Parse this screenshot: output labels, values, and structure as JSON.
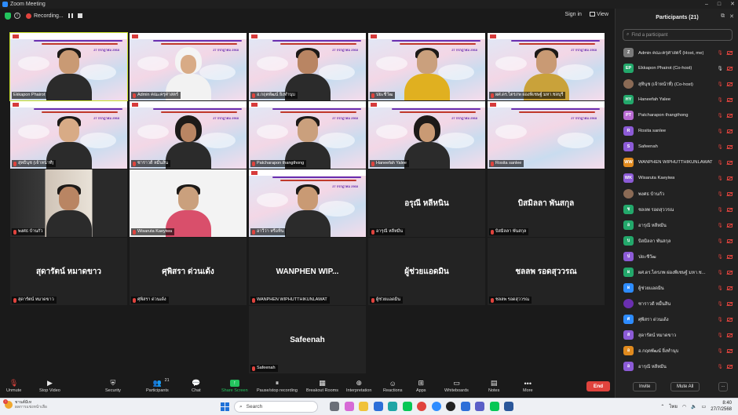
{
  "window": {
    "title": "Zoom Meeting",
    "controls": [
      "–",
      "□",
      "✕"
    ]
  },
  "meeting_bar": {
    "recording_label": "Recording...",
    "sign_in": "Sign in",
    "view": "View"
  },
  "slide": {
    "date": "27 กรกฎาคม 2568"
  },
  "tiles": [
    {
      "name": "Ekkapon Phairot",
      "video": true,
      "active": true,
      "person": "man-glasses"
    },
    {
      "name": "Admin คณะครุศาสตร์",
      "video": true,
      "person": "woman-hijab-white"
    },
    {
      "name": "อ.กฤตพัฒน์ ยิ่งทำนุบ",
      "video": true,
      "person": "man-glasses"
    },
    {
      "name": "ปยะชีวัฒ",
      "video": true,
      "person": "man-yellow"
    },
    {
      "name": "ผศ.ดร.ไตรภพ ผ่องพิเชษฐ์ มหา.ชลบุรี",
      "video": true,
      "person": "man-batik"
    },
    {
      "name": "สุทธินุช (เจ้าหน้าที่)",
      "video": true,
      "person": "man-young"
    },
    {
      "name": "ซาราวดี หมื่นสิน",
      "video": true,
      "person": "woman-hijab-black"
    },
    {
      "name": "Patcharapon thangthong",
      "video": true,
      "person": "woman-young"
    },
    {
      "name": "Haneefah Yalee",
      "video": true,
      "person": "woman-hijab-black"
    },
    {
      "name": "Rosita sanlee",
      "video": true,
      "person": "none"
    },
    {
      "name": "พงศธ บ้านกัว",
      "video": true,
      "person": "woman-room"
    },
    {
      "name": "Wisaruta Kaeyiwa",
      "video": true,
      "person": "woman-white"
    },
    {
      "name": "อาวีว่า หรือทิน",
      "video": true,
      "person": "woman-young"
    },
    {
      "name": "อารุณี หลีหมีน",
      "big": "อรุณี หลีหนิน",
      "video": false
    },
    {
      "name": "บิสมิลลา พันสกุล",
      "big": "บิสมิลลา พันสกุล",
      "video": false
    },
    {
      "name": "สุดารัตน์ หมาดขาว",
      "big": "สุดารัตน์ หมาดขาว",
      "video": false
    },
    {
      "name": "ศุพิสรา ด่วนเด้ง",
      "big": "ศุพิสรา ด่วนเด้ง",
      "video": false
    },
    {
      "name": "WANPHEN WIPHUTTHIKUNLAWAT",
      "big": "WANPHEN WIP...",
      "video": false
    },
    {
      "name": "ผู้ช่วยแอดมิน",
      "big": "ผู้ช่วยแอดมิน",
      "video": false
    },
    {
      "name": "ชลลพ รอดสุววรณ",
      "big": "ชลลพ รอดสุววรณ",
      "video": false
    },
    {
      "name": "Safeenah",
      "big": "Safeenah",
      "video": false
    }
  ],
  "toolbar": {
    "items": [
      {
        "label": "Unmute",
        "icon": "mic-muted-icon",
        "glyph": "🎙"
      },
      {
        "label": "Stop Video",
        "icon": "video-icon",
        "glyph": "▶"
      },
      {
        "label": "Security",
        "icon": "shield-icon",
        "glyph": "⛨"
      },
      {
        "label": "Participants",
        "icon": "participants-icon",
        "glyph": "👥",
        "count": "21"
      },
      {
        "label": "Chat",
        "icon": "chat-icon",
        "glyph": "💬"
      },
      {
        "label": "Share Screen",
        "icon": "share-screen-icon",
        "glyph": "↑"
      },
      {
        "label": "Pause/stop recording",
        "icon": "recording-icon",
        "glyph": "⏸"
      },
      {
        "label": "Breakout Rooms",
        "icon": "breakout-rooms-icon",
        "glyph": "▦"
      },
      {
        "label": "Interpretation",
        "icon": "globe-icon",
        "glyph": "⊕"
      },
      {
        "label": "Reactions",
        "icon": "reactions-icon",
        "glyph": "☺"
      },
      {
        "label": "Apps",
        "icon": "apps-icon",
        "glyph": "⊞"
      },
      {
        "label": "Whiteboards",
        "icon": "whiteboard-icon",
        "glyph": "▭"
      },
      {
        "label": "Notes",
        "icon": "notes-icon",
        "glyph": "▤"
      },
      {
        "label": "More",
        "icon": "more-icon",
        "glyph": "•••"
      }
    ],
    "end_label": "End"
  },
  "panel": {
    "title": "Participants (21)",
    "search_placeholder": "Find a participant",
    "participants": [
      {
        "name": "Admin คณะครุศาสตร์ (Host, me)",
        "initials": "Z",
        "color": "#7a7a7a",
        "mic": "off",
        "cam": "off"
      },
      {
        "name": "Ekkapon Phairot (Co-host)",
        "initials": "EP",
        "color": "#23a86b",
        "mic": "on",
        "cam": "off"
      },
      {
        "name": "สุทินุช (เจ้าหน้าที่) (Co-host)",
        "initials": "",
        "color": "#8a6a55",
        "photo": true,
        "mic": "off",
        "cam": "off"
      },
      {
        "name": "Haneefah Yalee",
        "initials": "HY",
        "color": "#23a86b",
        "mic": "off",
        "cam": "off"
      },
      {
        "name": "Patcharapon thangthong",
        "initials": "PT",
        "color": "#b86ad1",
        "mic": "off",
        "cam": "off"
      },
      {
        "name": "Rosita sanlee",
        "initials": "R",
        "color": "#8c5bd6",
        "mic": "off",
        "cam": "off"
      },
      {
        "name": "Safeenah",
        "initials": "S",
        "color": "#8c5bd6",
        "mic": "off",
        "cam": "off"
      },
      {
        "name": "WANPHEN WIPHUTTHIKUNLAWAT",
        "initials": "WW",
        "color": "#e08a1e",
        "mic": "off",
        "cam": "off"
      },
      {
        "name": "Wisaruta Kaeyiwa",
        "initials": "WK",
        "color": "#8c5bd6",
        "mic": "off",
        "cam": "off"
      },
      {
        "name": "พงศธ บ้านกัว",
        "initials": "",
        "color": "#8a6a55",
        "photo": true,
        "mic": "off",
        "cam": "off"
      },
      {
        "name": "ชลลพ รอดสุววรณ",
        "initials": "ช",
        "color": "#23a86b",
        "mic": "off",
        "cam": "off"
      },
      {
        "name": "อารุณี หลีหมีน",
        "initials": "อ",
        "color": "#23a86b",
        "mic": "off",
        "cam": "off"
      },
      {
        "name": "บิสมิลลา พันสกุล",
        "initials": "บ",
        "color": "#23a86b",
        "mic": "off",
        "cam": "off"
      },
      {
        "name": "ปยะชีวัฒ",
        "initials": "ป",
        "color": "#8c5bd6",
        "mic": "off",
        "cam": "off"
      },
      {
        "name": "ผศ.ดร.ไตรภพ ผ่องพิเชษฐ์ มหา.ช...",
        "initials": "ผ",
        "color": "#23a86b",
        "mic": "off",
        "cam": "off"
      },
      {
        "name": "ผู้ช่วยแอดมิน",
        "initials": "ผ",
        "color": "#2d8cff",
        "mic": "off",
        "cam": "off"
      },
      {
        "name": "ซาราวดี หมื่นสิน",
        "initials": "",
        "color": "#6a2fb0",
        "photo": true,
        "mic": "off",
        "cam": "off"
      },
      {
        "name": "ศุพิสรา ด่วนเด้ง",
        "initials": "ศ",
        "color": "#2d8cff",
        "mic": "off",
        "cam": "off"
      },
      {
        "name": "สุดารัตน์ หมาดขาว",
        "initials": "ส",
        "color": "#8c5bd6",
        "mic": "off",
        "cam": "off"
      },
      {
        "name": "อ.กฤตพัฒน์ ยิ่งทำนุบ",
        "initials": "อ",
        "color": "#e08a1e",
        "mic": "off",
        "cam": "off"
      },
      {
        "name": "อารุณี หลีหมีน",
        "initials": "อ",
        "color": "#8c5bd6",
        "mic": "off",
        "cam": "off"
      }
    ],
    "invite_label": "Invite",
    "mute_all_label": "Mute All",
    "more_label": "..."
  },
  "taskbar": {
    "weather_line1": "ชานต์มีเท",
    "weather_line2": "ผลการแข่งหน้าเลือ",
    "search_placeholder": "Search",
    "lang": "ไทย",
    "time": "8:40",
    "date": "27/7/2568",
    "apps": [
      {
        "icon": "task-view-icon",
        "color": "#6b6f78"
      },
      {
        "icon": "copilot-icon",
        "color": "#d66ad6"
      },
      {
        "icon": "file-explorer-icon",
        "color": "#f0c23a"
      },
      {
        "icon": "store-icon",
        "color": "#2d6fd8"
      },
      {
        "icon": "edge-icon",
        "color": "#1fa5a5"
      },
      {
        "icon": "line-icon",
        "color": "#06c755"
      },
      {
        "icon": "chrome-icon",
        "color": "#e0433d"
      },
      {
        "icon": "zoom-icon",
        "color": "#2d8cff"
      },
      {
        "icon": "media-icon",
        "color": "#222222"
      },
      {
        "icon": "photos-icon",
        "color": "#2d6fd8"
      },
      {
        "icon": "teams-icon",
        "color": "#5b5fc7"
      },
      {
        "icon": "line-app-icon",
        "color": "#06c755"
      },
      {
        "icon": "word-icon",
        "color": "#2b579a"
      }
    ]
  }
}
